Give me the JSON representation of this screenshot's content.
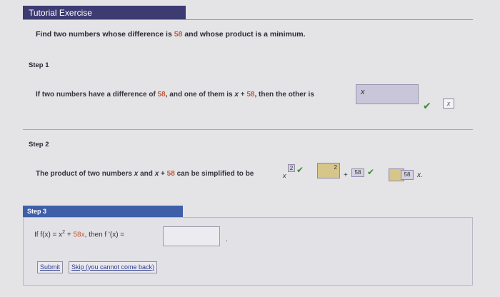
{
  "header": {
    "title": "Tutorial Exercise"
  },
  "question": {
    "prefix": "Find two numbers whose difference is",
    "diff": "58",
    "suffix": "and whose product is a minimum."
  },
  "step1": {
    "label": "Step 1",
    "text_a": "If two numbers have a difference of",
    "num_a": "58",
    "text_b": ", and one of them is",
    "expr_var": "x",
    "text_c": "+",
    "num_b": "58",
    "text_d": ", then the other is",
    "answer": "x",
    "hint_icon_label": "x"
  },
  "step2": {
    "label": "Step 2",
    "text_a": "The product of two numbers",
    "var_x": "x",
    "text_b": "and",
    "text_c": "+",
    "num_a": "58",
    "text_d": "can be simplified to be",
    "base_var": "x",
    "exp_answer": "2",
    "coef_box_exp": "2",
    "plus": "+",
    "const_answer": "58",
    "coef2_answer": "58",
    "tail_var": "x."
  },
  "step3": {
    "label": "Step 3",
    "text_a": "If f(x) = x",
    "exp": "2",
    "text_b": "+",
    "num_a": "58x",
    "text_c": ", then f '(x) =",
    "answer_value": "",
    "period": "."
  },
  "buttons": {
    "submit": "Submit",
    "skip": "Skip (you cannot come back)"
  }
}
